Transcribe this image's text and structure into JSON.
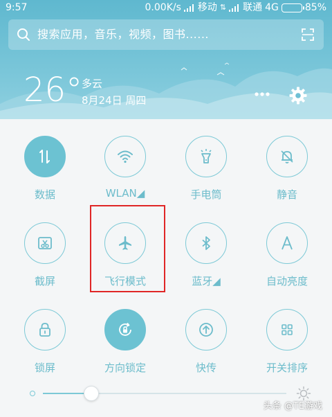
{
  "status_bar": {
    "time": "9:57",
    "speed": "0.00K/s",
    "carrier1": "移动",
    "carrier2": "联通",
    "network": "4G",
    "battery": "85%",
    "battery_level": 0.85
  },
  "search": {
    "placeholder": "搜索应用，音乐，视频，图书......"
  },
  "weather": {
    "temperature": "26°",
    "condition": "多云",
    "date": "8月24日 周四"
  },
  "toggles": [
    {
      "label": "数据",
      "icon": "data-arrows-icon",
      "active": true
    },
    {
      "label": "WLAN◢",
      "icon": "wifi-icon",
      "active": false
    },
    {
      "label": "手电筒",
      "icon": "flashlight-icon",
      "active": false
    },
    {
      "label": "静音",
      "icon": "bell-muted-icon",
      "active": false
    },
    {
      "label": "截屏",
      "icon": "screenshot-icon",
      "active": false
    },
    {
      "label": "飞行模式",
      "icon": "airplane-icon",
      "active": false
    },
    {
      "label": "蓝牙◢",
      "icon": "bluetooth-icon",
      "active": false
    },
    {
      "label": "自动亮度",
      "icon": "auto-brightness-icon",
      "active": false
    },
    {
      "label": "锁屏",
      "icon": "lock-icon",
      "active": false
    },
    {
      "label": "方向锁定",
      "icon": "rotation-lock-icon",
      "active": true
    },
    {
      "label": "快传",
      "icon": "quick-transfer-icon",
      "active": false
    },
    {
      "label": "开关排序",
      "icon": "grid-sort-icon",
      "active": false
    }
  ],
  "brightness": {
    "level": 0.2
  },
  "watermark": "头条 @TE游戏",
  "colors": {
    "accent": "#6cc2d2",
    "header": "#6fc0d5",
    "highlight": "#e02626"
  }
}
